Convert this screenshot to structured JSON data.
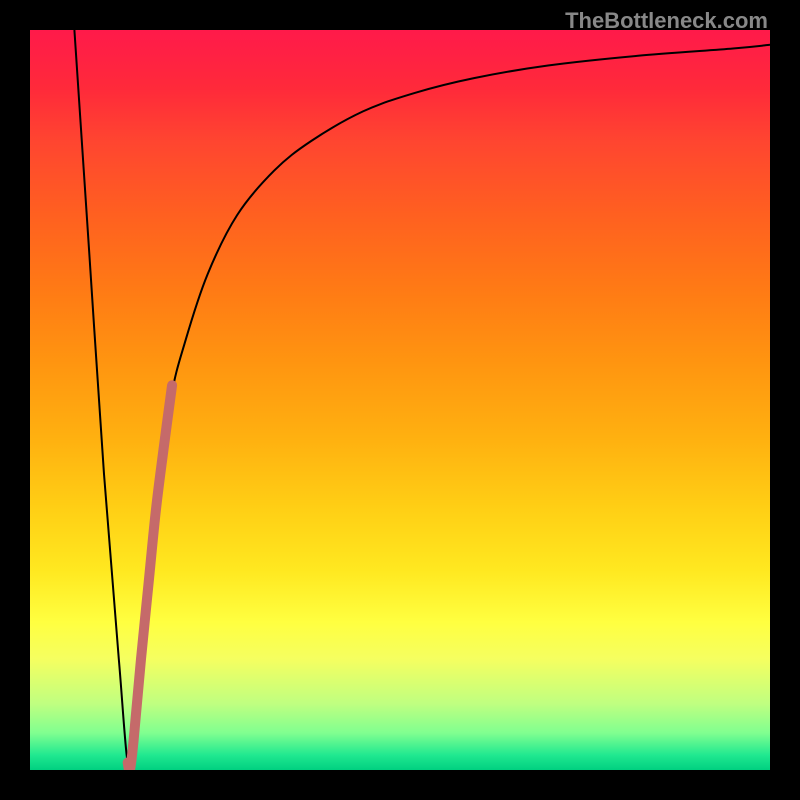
{
  "watermark": "TheBottleneck.com",
  "chart_data": {
    "type": "line",
    "title": "",
    "xlabel": "",
    "ylabel": "",
    "xlim": [
      0,
      100
    ],
    "ylim": [
      0,
      100
    ],
    "background_gradient": {
      "top": "#ff1a4a",
      "middle": "#ffff40",
      "bottom": "#00d080"
    },
    "series": [
      {
        "name": "main-curve",
        "color": "#000000",
        "stroke_width": 2,
        "x": [
          6,
          8,
          10,
          12,
          13.5,
          15,
          17,
          19,
          21,
          24,
          28,
          33,
          38,
          45,
          52,
          60,
          70,
          82,
          95,
          100
        ],
        "y": [
          100,
          70,
          40,
          15,
          0,
          15,
          35,
          50,
          58,
          67,
          75,
          81,
          85,
          89,
          91.5,
          93.5,
          95.2,
          96.5,
          97.5,
          98
        ]
      },
      {
        "name": "highlight-segment",
        "color": "#c56a6a",
        "stroke_width": 10,
        "x": [
          13.2,
          13.5,
          14,
          15,
          16,
          17,
          18,
          19.2
        ],
        "y": [
          1,
          0,
          4,
          15,
          25,
          35,
          43,
          52
        ]
      }
    ]
  }
}
